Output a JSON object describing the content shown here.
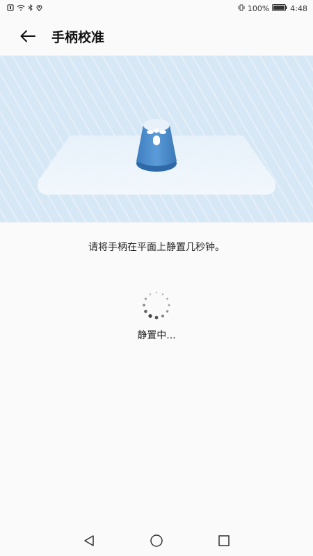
{
  "status_bar": {
    "battery_percent": "100%",
    "time": "4:48"
  },
  "header": {
    "title": "手柄校准"
  },
  "instruction": "请将手柄在平面上静置几秒钟。",
  "calibration_status": "静置中..."
}
